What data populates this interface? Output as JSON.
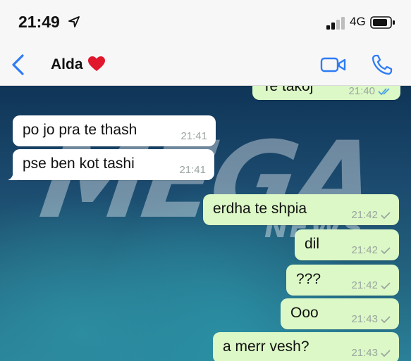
{
  "status_bar": {
    "time": "21:49",
    "network": "4G"
  },
  "header": {
    "contact_name": "Alda"
  },
  "watermark": {
    "main": "MEGA",
    "sub": "NEWS"
  },
  "messages": [
    {
      "text": "Te takoj",
      "time": "21:40",
      "direction": "out",
      "ticks": "double-blue"
    },
    {
      "text": "po jo pra te thash",
      "time": "21:41",
      "direction": "in"
    },
    {
      "text": "pse ben kot tashi",
      "time": "21:41",
      "direction": "in"
    },
    {
      "text": "erdha te shpia",
      "time": "21:42",
      "direction": "out",
      "ticks": "single"
    },
    {
      "text": "dil",
      "time": "21:42",
      "direction": "out",
      "ticks": "single"
    },
    {
      "text": "???",
      "time": "21:42",
      "direction": "out",
      "ticks": "single"
    },
    {
      "text": "Ooo",
      "time": "21:43",
      "direction": "out",
      "ticks": "single"
    },
    {
      "text": "a merr vesh?",
      "time": "21:43",
      "direction": "out",
      "ticks": "single"
    }
  ],
  "colors": {
    "accent": "#2f7cf6",
    "incoming_bubble": "#ffffff",
    "outgoing_bubble": "#dcf8c6",
    "read_tick": "#4fa3e0",
    "sent_tick": "#9aa5a0"
  },
  "icons": [
    "location-arrow-icon",
    "signal-icon",
    "battery-icon",
    "back-chevron-icon",
    "heart-icon",
    "video-call-icon",
    "phone-call-icon",
    "check-icon",
    "double-check-icon"
  ]
}
